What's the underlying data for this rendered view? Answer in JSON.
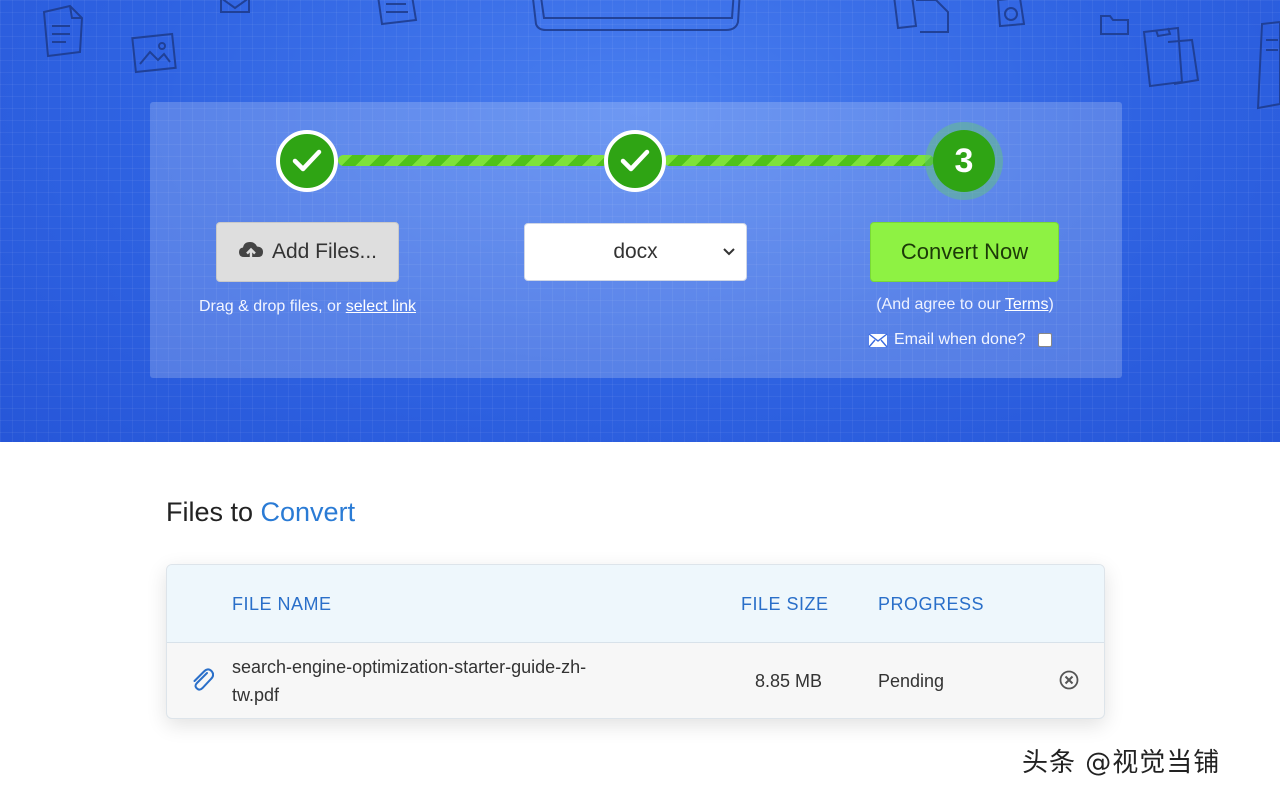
{
  "colors": {
    "brand_blue": "#2f63e2",
    "step_green": "#2fa414",
    "convert_green": "#8ef243",
    "accent_blue": "#2a7bd5"
  },
  "stepper": {
    "steps": [
      {
        "state": "done",
        "icon": "check-icon"
      },
      {
        "state": "done",
        "icon": "check-icon"
      },
      {
        "state": "current",
        "label": "3"
      }
    ]
  },
  "upload": {
    "add_files_label": "Add Files...",
    "hint_prefix": "Drag & drop files, or ",
    "hint_link": "select link"
  },
  "format": {
    "selected": "docx"
  },
  "convert": {
    "button_label": "Convert Now",
    "agree_prefix": "(And agree to our ",
    "agree_link": "Terms",
    "agree_suffix": ")",
    "email_label": "Email when done?",
    "email_checked": false
  },
  "files_section": {
    "title_prefix": "Files to ",
    "title_accent": "Convert",
    "columns": [
      "FILE NAME",
      "FILE SIZE",
      "PROGRESS"
    ],
    "rows": [
      {
        "name_line1": "search-engine-optimization-starter-guide-zh-",
        "name_line2": "tw.pdf",
        "size": "8.85 MB",
        "progress": "Pending"
      }
    ]
  },
  "watermark": "头条 @视觉当铺"
}
